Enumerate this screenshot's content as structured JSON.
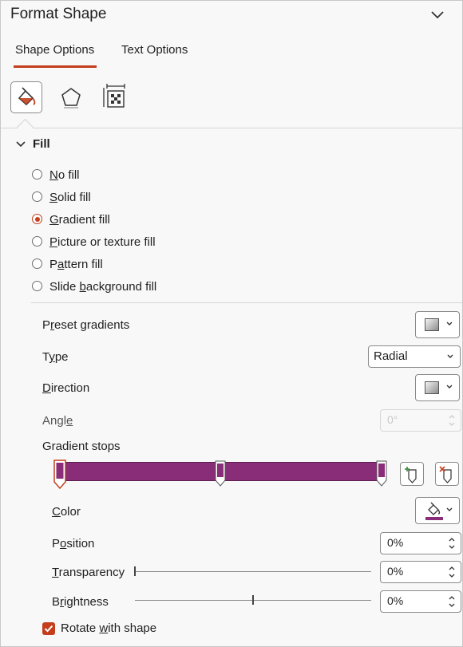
{
  "pane": {
    "title": "Format Shape"
  },
  "tabs": [
    {
      "label": "Shape Options",
      "active": true
    },
    {
      "label": "Text Options",
      "active": false
    }
  ],
  "categories": [
    "fill-line-icon",
    "effects-icon",
    "size-properties-icon"
  ],
  "fill": {
    "section_title": "Fill",
    "options": [
      {
        "pre": "",
        "key": "N",
        "post": "o fill",
        "selected": false
      },
      {
        "pre": "",
        "key": "S",
        "post": "olid fill",
        "selected": false
      },
      {
        "pre": "",
        "key": "G",
        "post": "radient fill",
        "selected": true
      },
      {
        "pre": "",
        "key": "P",
        "post": "icture or texture fill",
        "selected": false
      },
      {
        "pre": "P",
        "key": "a",
        "post": "ttern fill",
        "selected": false
      },
      {
        "pre": "Slide ",
        "key": "b",
        "post": "ackground fill",
        "selected": false
      }
    ],
    "preset": {
      "pre": "P",
      "key": "r",
      "post": "eset gradients"
    },
    "type": {
      "pre": "T",
      "key": "y",
      "post": "pe",
      "value": "Radial"
    },
    "direction": {
      "pre": "",
      "key": "D",
      "post": "irection"
    },
    "angle": {
      "pre": "Angl",
      "key": "e",
      "post": "",
      "value": "0°",
      "disabled": true
    },
    "gradient_stops": {
      "label": "Gradient stops",
      "stops_pct": [
        0,
        50,
        100
      ],
      "selected_stop": 0,
      "color": "#8a2d78"
    },
    "color": {
      "pre": "",
      "key": "C",
      "post": "olor"
    },
    "position": {
      "pre": "P",
      "key": "o",
      "post": "sition",
      "value": "0%"
    },
    "transparency": {
      "pre": "",
      "key": "T",
      "post": "ransparency",
      "value": "0%",
      "level": 0
    },
    "brightness": {
      "pre": "B",
      "key": "r",
      "post": "ightness",
      "value": "0%",
      "level": 0.5
    },
    "rotate": {
      "pre": "Rotate ",
      "key": "w",
      "post": "ith shape",
      "checked": true
    }
  },
  "colors": {
    "accent": "#c43e1c",
    "gradient": "#8a2d78"
  }
}
